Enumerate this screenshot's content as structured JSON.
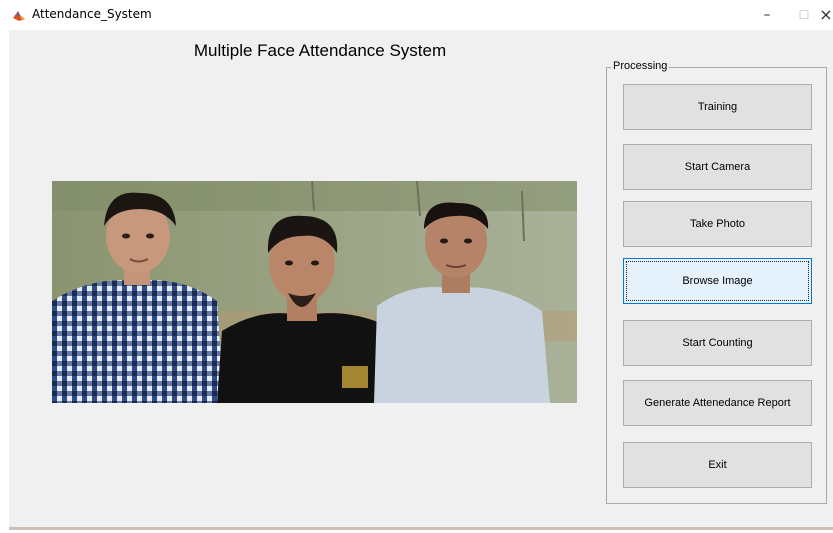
{
  "window": {
    "title": "Attendance_System",
    "minimize_glyph": "–",
    "maximize_glyph": "☐",
    "close_glyph": "×",
    "icon": "matlab-icon"
  },
  "main": {
    "title": "Multiple Face Attendance System"
  },
  "processing": {
    "label": "Processing",
    "buttons": {
      "training": "Training",
      "start_camera": "Start Camera",
      "take_photo": "Take Photo",
      "browse_image": "Browse Image",
      "start_counting": "Start Counting",
      "generate_report": "Generate Attenedance Report",
      "exit": "Exit"
    }
  },
  "colors": {
    "client_bg": "#f0f0f0",
    "button_bg": "#e1e1e1",
    "focused_button_bg": "#e5f1fb",
    "focused_border": "#0078d7"
  }
}
